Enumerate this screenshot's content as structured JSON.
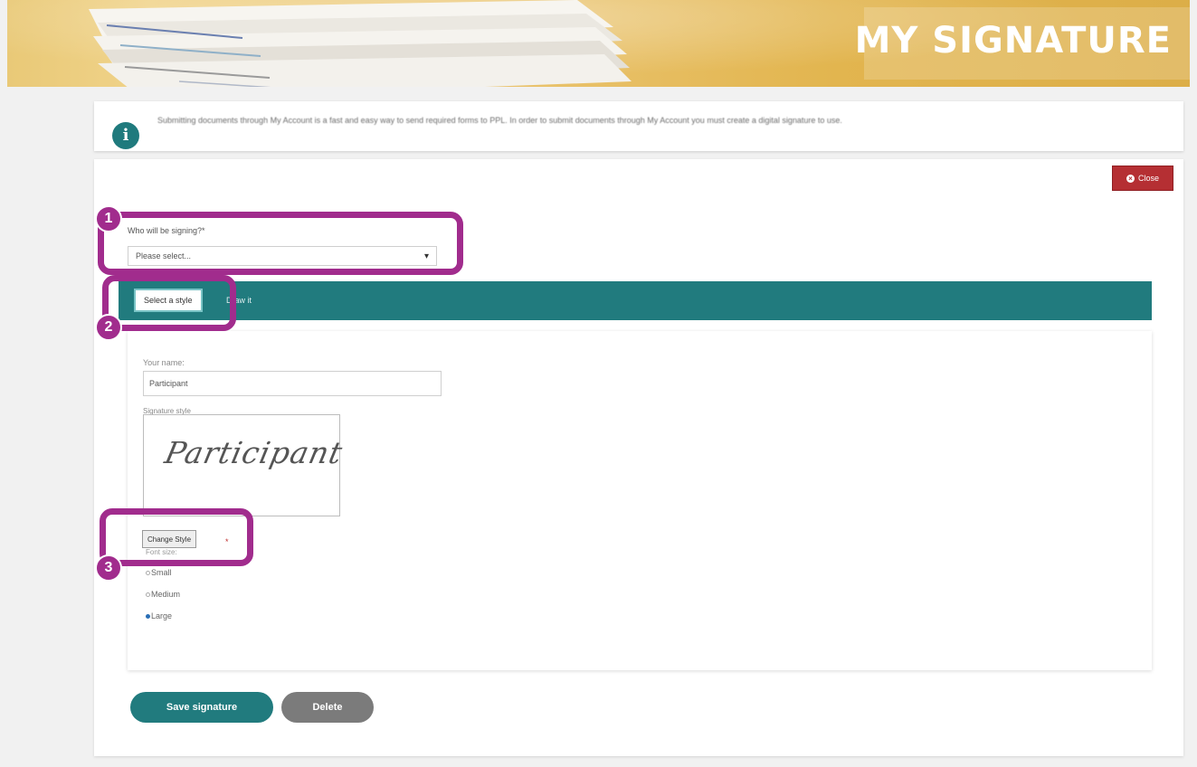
{
  "banner": {
    "title": "MY SIGNATURE"
  },
  "info": {
    "text": "Submitting documents through My Account is a fast and easy way to send required forms to PPL. In order to submit documents through My Account you must create a digital signature to use."
  },
  "close_button": {
    "label": "Close"
  },
  "signer": {
    "label": "Who will be signing?*",
    "selected": "Please select..."
  },
  "tabs": [
    {
      "label": "Select a style"
    },
    {
      "label": "Draw it"
    }
  ],
  "style_form": {
    "name_label": "Your name:",
    "name_value": "Participant",
    "signature_style_label": "Signature style",
    "signature_preview": "Participant",
    "change_style_label": "Change Style",
    "required_mark": "*",
    "size_label": "Font size:",
    "sizes": [
      {
        "label": "Small",
        "checked": false
      },
      {
        "label": "Medium",
        "checked": false
      },
      {
        "label": "Large",
        "checked": true
      }
    ]
  },
  "actions": {
    "save_label": "Save signature",
    "delete_label": "Delete"
  },
  "annotations": [
    {
      "number": "1"
    },
    {
      "number": "2"
    },
    {
      "number": "3"
    }
  ],
  "colors": {
    "teal": "#217b7e",
    "close_red": "#b52f33",
    "annotation_purple": "#a12c8d",
    "banner_gold": "#e2b54f"
  }
}
